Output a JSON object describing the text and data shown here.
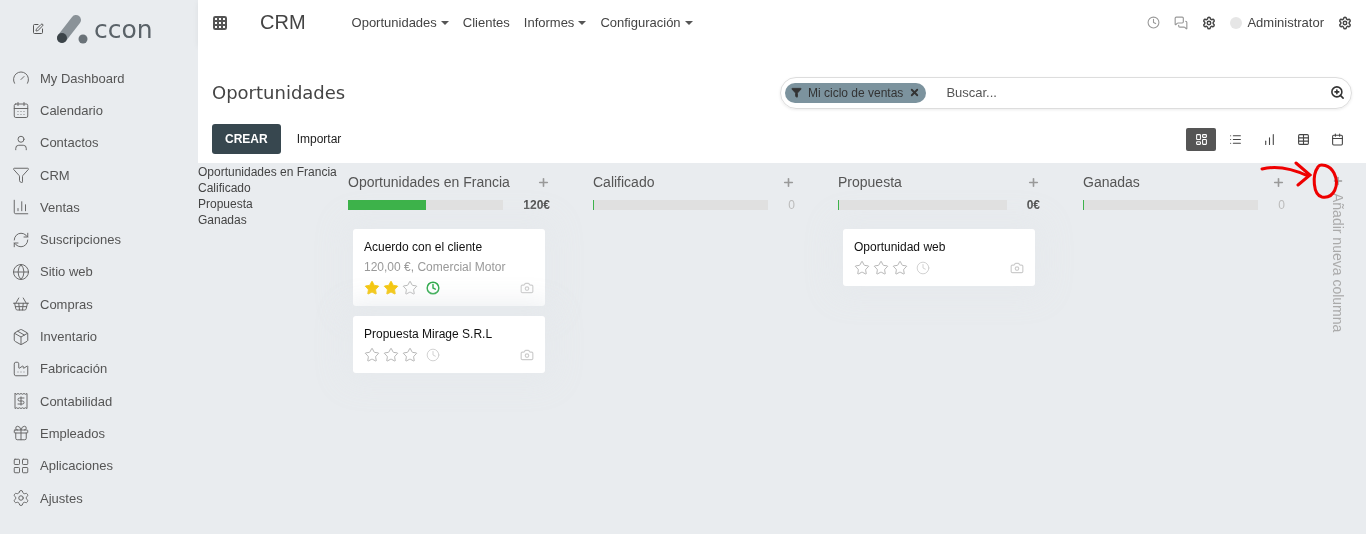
{
  "sidebar": {
    "logo_text": "ccon",
    "items": [
      {
        "label": "My Dashboard"
      },
      {
        "label": "Calendario"
      },
      {
        "label": "Contactos"
      },
      {
        "label": "CRM"
      },
      {
        "label": "Ventas"
      },
      {
        "label": "Suscripciones"
      },
      {
        "label": "Sitio web"
      },
      {
        "label": "Compras"
      },
      {
        "label": "Inventario"
      },
      {
        "label": "Fabricación"
      },
      {
        "label": "Contabilidad"
      },
      {
        "label": "Empleados"
      },
      {
        "label": "Aplicaciones"
      },
      {
        "label": "Ajustes"
      }
    ]
  },
  "topbar": {
    "app": "CRM",
    "menu": [
      {
        "label": "Oportunidades",
        "dropdown": true
      },
      {
        "label": "Clientes",
        "dropdown": false
      },
      {
        "label": "Informes",
        "dropdown": true
      },
      {
        "label": "Configuración",
        "dropdown": true
      }
    ],
    "user": "Administrator"
  },
  "page": {
    "title": "Oportunidades",
    "create_button": "CREAR",
    "import_button": "Importar",
    "search": {
      "filter": "Mi ciclo de ventas",
      "placeholder": "Buscar..."
    },
    "views": [
      {
        "kind": "kanban",
        "selected": true
      },
      {
        "kind": "list",
        "selected": false
      },
      {
        "kind": "graph",
        "selected": false
      },
      {
        "kind": "pivot",
        "selected": false
      },
      {
        "kind": "calendar",
        "selected": false
      }
    ]
  },
  "stage_list": [
    "Oportunidades en Francia",
    "Calificado",
    "Propuesta",
    "Ganadas"
  ],
  "columns": [
    {
      "title": "Oportunidades en Francia",
      "level": 0.5,
      "total": "120€",
      "emphasized": true,
      "cards": [
        {
          "title": "Acuerdo con el cliente",
          "subtitle": "120,00 €, Comercial Motor",
          "stars": 2,
          "activity_due": true
        },
        {
          "title": "Propuesta Mirage S.R.L",
          "stars": 0,
          "activity_due": false
        }
      ]
    },
    {
      "title": "Calificado",
      "level": 0,
      "total": "0",
      "emphasized": false
    },
    {
      "title": "Propuesta",
      "level": 0,
      "total": "0€",
      "emphasized": true,
      "cards": [
        {
          "title": "Oportunidad web",
          "stars": 0,
          "activity_due": false
        }
      ]
    },
    {
      "title": "Ganadas",
      "level": 0,
      "total": "0",
      "emphasized": false
    }
  ],
  "add_column": {
    "label": "Añadir nueva columna"
  }
}
